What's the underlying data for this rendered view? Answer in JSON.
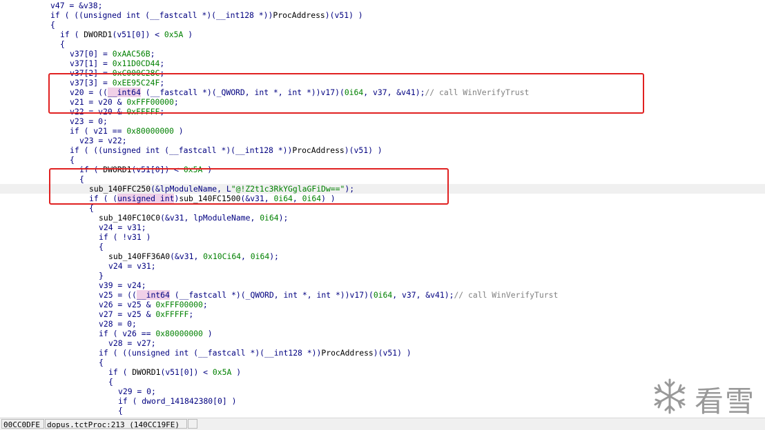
{
  "code": {
    "lines": [
      {
        "indent": 5,
        "current": false,
        "tokens": [
          [
            "var",
            "v47"
          ],
          [
            "txt",
            " = &"
          ],
          [
            "var",
            "v38"
          ],
          [
            "txt",
            ";"
          ]
        ]
      },
      {
        "indent": 5,
        "current": false,
        "tokens": [
          [
            "kw",
            "if"
          ],
          [
            "txt",
            " ( (("
          ],
          [
            "tp",
            "unsigned int"
          ],
          [
            "txt",
            " ("
          ],
          [
            "tp",
            "__fastcall"
          ],
          [
            "txt",
            " *)("
          ],
          [
            "tp",
            "__int128"
          ],
          [
            "txt",
            " *))"
          ],
          [
            "fn",
            "ProcAddress"
          ],
          [
            "txt",
            ")("
          ],
          [
            "var",
            "v51"
          ],
          [
            "txt",
            ") )"
          ]
        ]
      },
      {
        "indent": 5,
        "current": false,
        "tokens": [
          [
            "txt",
            "{"
          ]
        ]
      },
      {
        "indent": 6,
        "current": false,
        "tokens": [
          [
            "kw",
            "if"
          ],
          [
            "txt",
            " ( "
          ],
          [
            "fn",
            "DWORD1"
          ],
          [
            "txt",
            "("
          ],
          [
            "var",
            "v51"
          ],
          [
            "txt",
            "[0]) < "
          ],
          [
            "num",
            "0x5A"
          ],
          [
            "txt",
            " )"
          ]
        ]
      },
      {
        "indent": 6,
        "current": false,
        "tokens": [
          [
            "txt",
            "{"
          ]
        ]
      },
      {
        "indent": 7,
        "current": false,
        "tokens": [
          [
            "var",
            "v37"
          ],
          [
            "txt",
            "[0] = "
          ],
          [
            "num",
            "0xAAC56B"
          ],
          [
            "txt",
            ";"
          ]
        ]
      },
      {
        "indent": 7,
        "current": false,
        "tokens": [
          [
            "var",
            "v37"
          ],
          [
            "txt",
            "[1] = "
          ],
          [
            "num",
            "0x11D0CD44"
          ],
          [
            "txt",
            ";"
          ]
        ]
      },
      {
        "indent": 7,
        "current": false,
        "tokens": [
          [
            "var",
            "v37"
          ],
          [
            "txt",
            "[2] = "
          ],
          [
            "num",
            "0xC000C28C"
          ],
          [
            "txt",
            ";"
          ]
        ]
      },
      {
        "indent": 7,
        "current": false,
        "tokens": [
          [
            "var",
            "v37"
          ],
          [
            "txt",
            "[3] = "
          ],
          [
            "num",
            "0xEE95C24F"
          ],
          [
            "txt",
            ";"
          ]
        ]
      },
      {
        "indent": 7,
        "current": false,
        "tokens": [
          [
            "var",
            "v20"
          ],
          [
            "txt",
            " = (("
          ],
          [
            "hl",
            "__int64"
          ],
          [
            "txt",
            " ("
          ],
          [
            "tp",
            "__fastcall"
          ],
          [
            "txt",
            " *)("
          ],
          [
            "tp",
            "_QWORD"
          ],
          [
            "txt",
            ", "
          ],
          [
            "tp",
            "int"
          ],
          [
            "txt",
            " *, "
          ],
          [
            "tp",
            "int"
          ],
          [
            "txt",
            " *))"
          ],
          [
            "var",
            "v17"
          ],
          [
            "txt",
            ")("
          ],
          [
            "num",
            "0i64"
          ],
          [
            "txt",
            ", "
          ],
          [
            "var",
            "v37"
          ],
          [
            "txt",
            ", &"
          ],
          [
            "var",
            "v41"
          ],
          [
            "txt",
            ");"
          ],
          [
            "cm",
            "// call WinVerifyTrust"
          ]
        ]
      },
      {
        "indent": 7,
        "current": false,
        "tokens": [
          [
            "var",
            "v21"
          ],
          [
            "txt",
            " = "
          ],
          [
            "var",
            "v20"
          ],
          [
            "txt",
            " & "
          ],
          [
            "num",
            "0xFFF00000"
          ],
          [
            "txt",
            ";"
          ]
        ]
      },
      {
        "indent": 7,
        "current": false,
        "tokens": [
          [
            "var",
            "v22"
          ],
          [
            "txt",
            " = "
          ],
          [
            "var",
            "v20"
          ],
          [
            "txt",
            " & "
          ],
          [
            "num",
            "0xFFFFF"
          ],
          [
            "txt",
            ";"
          ]
        ]
      },
      {
        "indent": 7,
        "current": false,
        "tokens": [
          [
            "var",
            "v23"
          ],
          [
            "txt",
            " = 0;"
          ]
        ]
      },
      {
        "indent": 7,
        "current": false,
        "tokens": [
          [
            "kw",
            "if"
          ],
          [
            "txt",
            " ( "
          ],
          [
            "var",
            "v21"
          ],
          [
            "txt",
            " == "
          ],
          [
            "num",
            "0x80000000"
          ],
          [
            "txt",
            " )"
          ]
        ]
      },
      {
        "indent": 8,
        "current": false,
        "tokens": [
          [
            "var",
            "v23"
          ],
          [
            "txt",
            " = "
          ],
          [
            "var",
            "v22"
          ],
          [
            "txt",
            ";"
          ]
        ]
      },
      {
        "indent": 7,
        "current": false,
        "tokens": [
          [
            "kw",
            "if"
          ],
          [
            "txt",
            " ( (("
          ],
          [
            "tp",
            "unsigned int"
          ],
          [
            "txt",
            " ("
          ],
          [
            "tp",
            "__fastcall"
          ],
          [
            "txt",
            " *)("
          ],
          [
            "tp",
            "__int128"
          ],
          [
            "txt",
            " *))"
          ],
          [
            "fn",
            "ProcAddress"
          ],
          [
            "txt",
            ")("
          ],
          [
            "var",
            "v51"
          ],
          [
            "txt",
            ") )"
          ]
        ]
      },
      {
        "indent": 7,
        "current": false,
        "tokens": [
          [
            "txt",
            "{"
          ]
        ]
      },
      {
        "indent": 8,
        "current": false,
        "tokens": [
          [
            "kw",
            "if"
          ],
          [
            "txt",
            " ( "
          ],
          [
            "fn",
            "DWORD1"
          ],
          [
            "txt",
            "("
          ],
          [
            "var",
            "v51"
          ],
          [
            "txt",
            "[0]) < "
          ],
          [
            "num",
            "0x5A"
          ],
          [
            "txt",
            " )"
          ]
        ]
      },
      {
        "indent": 8,
        "current": false,
        "tokens": [
          [
            "txt",
            "{"
          ]
        ]
      },
      {
        "indent": 9,
        "current": true,
        "tokens": [
          [
            "fn",
            "sub_140FFC250"
          ],
          [
            "txt",
            "(&"
          ],
          [
            "var",
            "lpModuleName"
          ],
          [
            "txt",
            ", "
          ],
          [
            "txt",
            "L"
          ],
          [
            "str",
            "\"@!Z2t1c3RkYGglaGFiDw==\""
          ],
          [
            "txt",
            ");"
          ]
        ]
      },
      {
        "indent": 9,
        "current": false,
        "tokens": [
          [
            "kw",
            "if"
          ],
          [
            "txt",
            " ( ("
          ],
          [
            "hl",
            "unsigned int"
          ],
          [
            "txt",
            ")"
          ],
          [
            "fn",
            "sub_140FC1500"
          ],
          [
            "txt",
            "(&"
          ],
          [
            "var",
            "v31"
          ],
          [
            "txt",
            ", "
          ],
          [
            "num",
            "0i64"
          ],
          [
            "txt",
            ", "
          ],
          [
            "num",
            "0i64"
          ],
          [
            "txt",
            ") )"
          ]
        ]
      },
      {
        "indent": 9,
        "current": false,
        "tokens": [
          [
            "txt",
            "{"
          ]
        ]
      },
      {
        "indent": 10,
        "current": false,
        "tokens": [
          [
            "fn",
            "sub_140FC10C0"
          ],
          [
            "txt",
            "(&"
          ],
          [
            "var",
            "v31"
          ],
          [
            "txt",
            ", "
          ],
          [
            "var",
            "lpModuleName"
          ],
          [
            "txt",
            ", "
          ],
          [
            "num",
            "0i64"
          ],
          [
            "txt",
            ");"
          ]
        ]
      },
      {
        "indent": 10,
        "current": false,
        "tokens": [
          [
            "var",
            "v24"
          ],
          [
            "txt",
            " = "
          ],
          [
            "var",
            "v31"
          ],
          [
            "txt",
            ";"
          ]
        ]
      },
      {
        "indent": 10,
        "current": false,
        "tokens": [
          [
            "kw",
            "if"
          ],
          [
            "txt",
            " ( !"
          ],
          [
            "var",
            "v31"
          ],
          [
            "txt",
            " )"
          ]
        ]
      },
      {
        "indent": 10,
        "current": false,
        "tokens": [
          [
            "txt",
            "{"
          ]
        ]
      },
      {
        "indent": 11,
        "current": false,
        "tokens": [
          [
            "fn",
            "sub_140FF36A0"
          ],
          [
            "txt",
            "(&"
          ],
          [
            "var",
            "v31"
          ],
          [
            "txt",
            ", "
          ],
          [
            "num",
            "0x10Ci64"
          ],
          [
            "txt",
            ", "
          ],
          [
            "num",
            "0i64"
          ],
          [
            "txt",
            ");"
          ]
        ]
      },
      {
        "indent": 11,
        "current": false,
        "tokens": [
          [
            "var",
            "v24"
          ],
          [
            "txt",
            " = "
          ],
          [
            "var",
            "v31"
          ],
          [
            "txt",
            ";"
          ]
        ]
      },
      {
        "indent": 10,
        "current": false,
        "tokens": [
          [
            "txt",
            "}"
          ]
        ]
      },
      {
        "indent": 10,
        "current": false,
        "tokens": [
          [
            "var",
            "v39"
          ],
          [
            "txt",
            " = "
          ],
          [
            "var",
            "v24"
          ],
          [
            "txt",
            ";"
          ]
        ]
      },
      {
        "indent": 10,
        "current": false,
        "tokens": [
          [
            "var",
            "v25"
          ],
          [
            "txt",
            " = (("
          ],
          [
            "hl",
            "__int64"
          ],
          [
            "txt",
            " ("
          ],
          [
            "tp",
            "__fastcall"
          ],
          [
            "txt",
            " *)("
          ],
          [
            "tp",
            "_QWORD"
          ],
          [
            "txt",
            ", "
          ],
          [
            "tp",
            "int"
          ],
          [
            "txt",
            " *, "
          ],
          [
            "tp",
            "int"
          ],
          [
            "txt",
            " *))"
          ],
          [
            "var",
            "v17"
          ],
          [
            "txt",
            ")("
          ],
          [
            "num",
            "0i64"
          ],
          [
            "txt",
            ", "
          ],
          [
            "var",
            "v37"
          ],
          [
            "txt",
            ", &"
          ],
          [
            "var",
            "v41"
          ],
          [
            "txt",
            ");"
          ],
          [
            "cm",
            "// call WinVerifyTurst"
          ]
        ]
      },
      {
        "indent": 10,
        "current": false,
        "tokens": [
          [
            "var",
            "v26"
          ],
          [
            "txt",
            " = "
          ],
          [
            "var",
            "v25"
          ],
          [
            "txt",
            " & "
          ],
          [
            "num",
            "0xFFF00000"
          ],
          [
            "txt",
            ";"
          ]
        ]
      },
      {
        "indent": 10,
        "current": false,
        "tokens": [
          [
            "var",
            "v27"
          ],
          [
            "txt",
            " = "
          ],
          [
            "var",
            "v25"
          ],
          [
            "txt",
            " & "
          ],
          [
            "num",
            "0xFFFFF"
          ],
          [
            "txt",
            ";"
          ]
        ]
      },
      {
        "indent": 10,
        "current": false,
        "tokens": [
          [
            "var",
            "v28"
          ],
          [
            "txt",
            " = 0;"
          ]
        ]
      },
      {
        "indent": 10,
        "current": false,
        "tokens": [
          [
            "kw",
            "if"
          ],
          [
            "txt",
            " ( "
          ],
          [
            "var",
            "v26"
          ],
          [
            "txt",
            " == "
          ],
          [
            "num",
            "0x80000000"
          ],
          [
            "txt",
            " )"
          ]
        ]
      },
      {
        "indent": 11,
        "current": false,
        "tokens": [
          [
            "var",
            "v28"
          ],
          [
            "txt",
            " = "
          ],
          [
            "var",
            "v27"
          ],
          [
            "txt",
            ";"
          ]
        ]
      },
      {
        "indent": 10,
        "current": false,
        "tokens": [
          [
            "kw",
            "if"
          ],
          [
            "txt",
            " ( (("
          ],
          [
            "tp",
            "unsigned int"
          ],
          [
            "txt",
            " ("
          ],
          [
            "tp",
            "__fastcall"
          ],
          [
            "txt",
            " *)("
          ],
          [
            "tp",
            "__int128"
          ],
          [
            "txt",
            " *))"
          ],
          [
            "fn",
            "ProcAddress"
          ],
          [
            "txt",
            ")("
          ],
          [
            "var",
            "v51"
          ],
          [
            "txt",
            ") )"
          ]
        ]
      },
      {
        "indent": 10,
        "current": false,
        "tokens": [
          [
            "txt",
            "{"
          ]
        ]
      },
      {
        "indent": 11,
        "current": false,
        "tokens": [
          [
            "kw",
            "if"
          ],
          [
            "txt",
            " ( "
          ],
          [
            "fn",
            "DWORD1"
          ],
          [
            "txt",
            "("
          ],
          [
            "var",
            "v51"
          ],
          [
            "txt",
            "[0]) < "
          ],
          [
            "num",
            "0x5A"
          ],
          [
            "txt",
            " )"
          ]
        ]
      },
      {
        "indent": 11,
        "current": false,
        "tokens": [
          [
            "txt",
            "{"
          ]
        ]
      },
      {
        "indent": 12,
        "current": false,
        "tokens": [
          [
            "var",
            "v29"
          ],
          [
            "txt",
            " = 0;"
          ]
        ]
      },
      {
        "indent": 12,
        "current": false,
        "tokens": [
          [
            "kw",
            "if"
          ],
          [
            "txt",
            " ( "
          ],
          [
            "var",
            "dword_141842380"
          ],
          [
            "txt",
            "[0] )"
          ]
        ]
      },
      {
        "indent": 12,
        "current": false,
        "tokens": [
          [
            "txt",
            "{"
          ]
        ]
      }
    ]
  },
  "annotations": [
    "red-box-1",
    "red-box-2"
  ],
  "statusbar": {
    "address": "00CC0DFE",
    "location": "dopus.tctProc:213 (140CC19FE)",
    "extra": ""
  },
  "watermark": {
    "text": "看雪",
    "icon": "snowflake-icon"
  },
  "colors": {
    "variable": "#000080",
    "number": "#008000",
    "function": "#000000",
    "string": "#008000",
    "comment": "#808080",
    "highlight": "#f0d0e8",
    "annotation_box": "#e02020"
  }
}
